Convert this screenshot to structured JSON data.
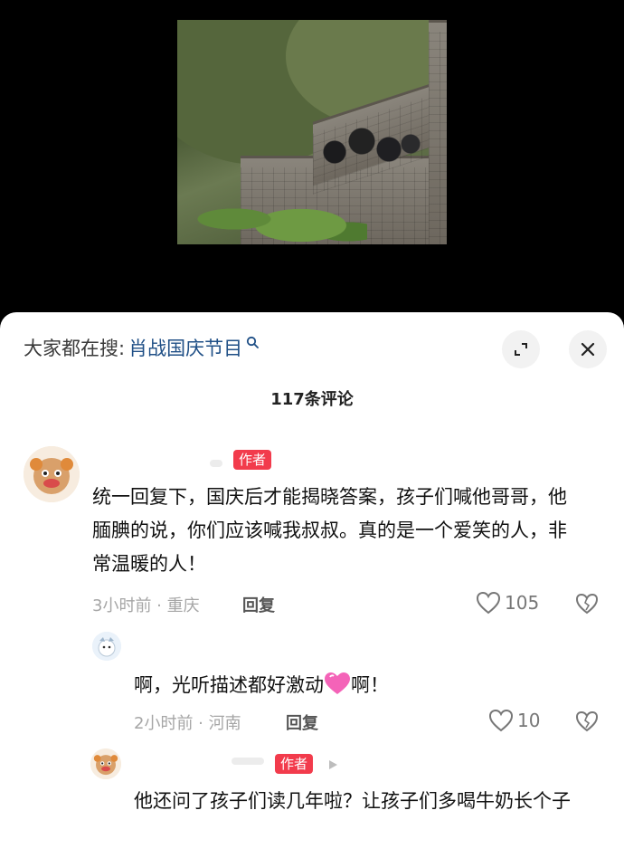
{
  "search": {
    "prefix": "大家都在搜:",
    "term": "肖战国庆节目"
  },
  "comments_header": {
    "count_label": "117条评论"
  },
  "comments": [
    {
      "badge": "作者",
      "text": "统一回复下，国庆后才能揭晓答案，孩子们喊他哥哥，他腼腆的说，你们应该喊我叔叔。真的是一个爱笑的人，非常温暖的人！",
      "time": "3小时前",
      "location": "重庆",
      "reply_label": "回复",
      "likes": "105"
    },
    {
      "text_before": "啊，光听描述都好激动",
      "text_after": "啊！",
      "time": "2小时前",
      "location": "河南",
      "reply_label": "回复",
      "likes": "10"
    },
    {
      "badge": "作者",
      "text": "他还问了孩子们读几年啦？让孩子们多喝牛奶长个子"
    }
  ],
  "colors": {
    "badge": "#f23b4c",
    "search_term": "#1f4f86",
    "meta": "#a6a6a6"
  }
}
